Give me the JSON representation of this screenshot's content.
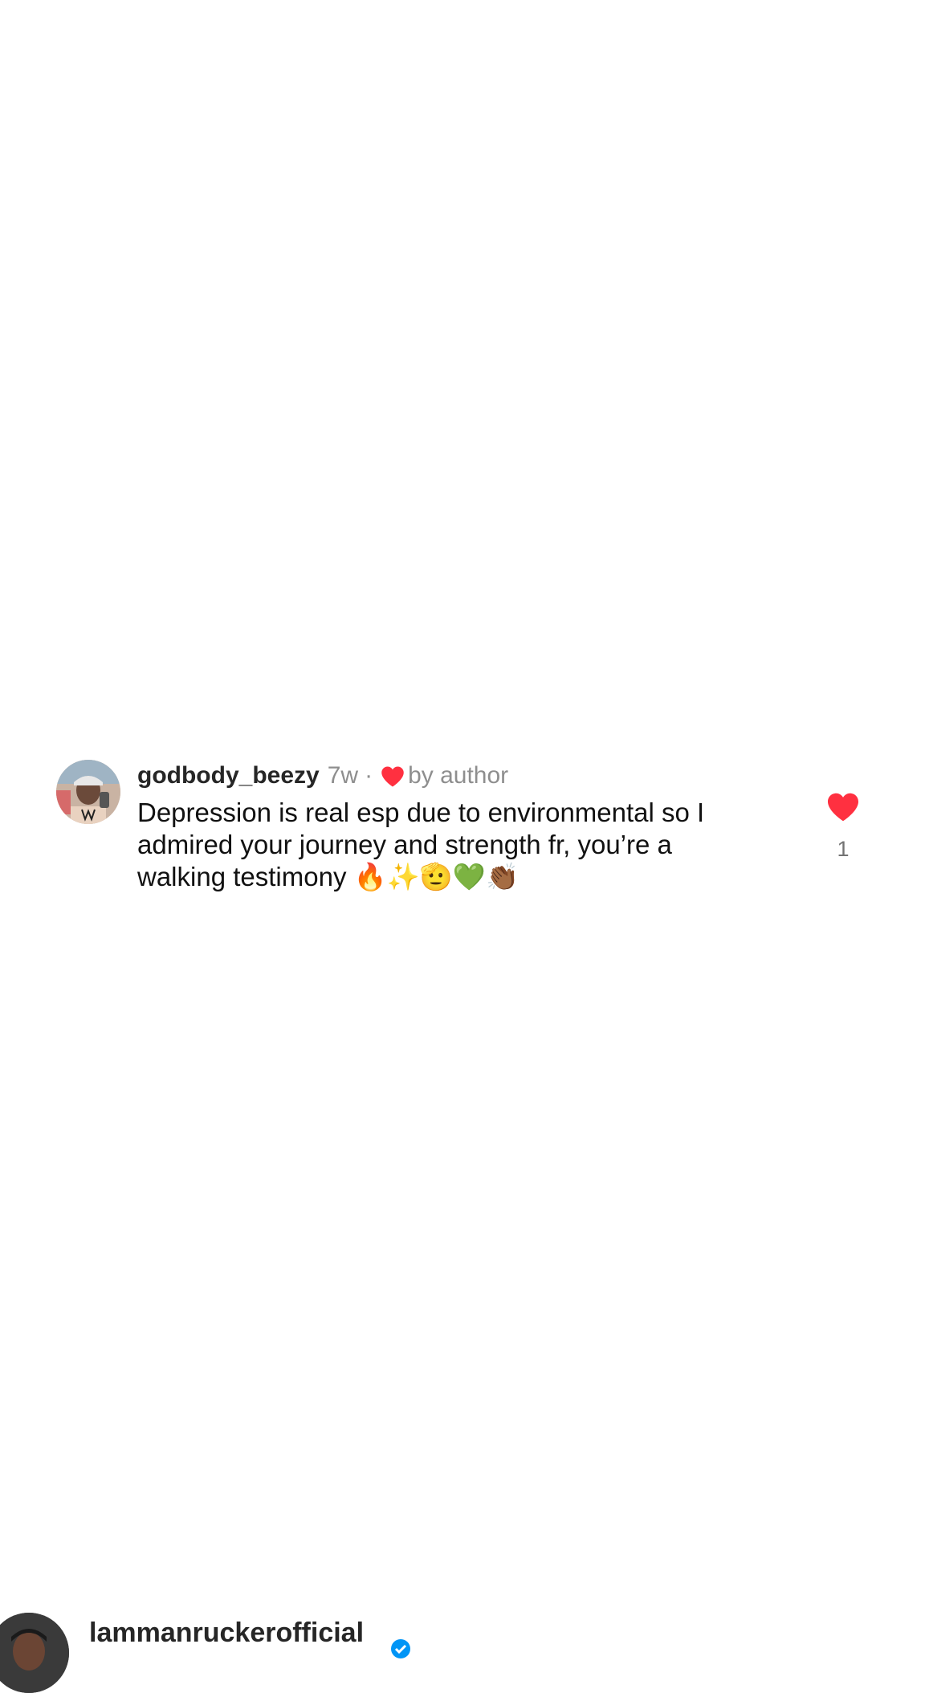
{
  "comment": {
    "username": "godbody_beezy",
    "timestamp": "7w",
    "separator": "·",
    "liked_by_author_label": "by author",
    "text": "Depression is real esp due to environmental so I admired your journey and strength fr, you’re a walking testimony ",
    "emojis": "🔥✨🫡💚👏🏾",
    "like_count": "1",
    "liked": true
  },
  "next_comment": {
    "username": "lammanruckerofficial"
  },
  "colors": {
    "heart": "#ff3040",
    "muted_text": "#8e8e8e",
    "verified": "#0095f6"
  },
  "icons": {
    "liked_by_author": "heart-icon",
    "like_button": "heart-filled-icon",
    "verified": "verified-badge-icon"
  }
}
